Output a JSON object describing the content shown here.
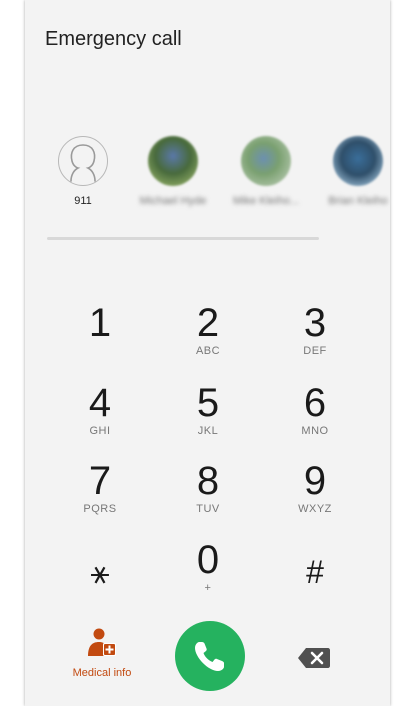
{
  "header": {
    "title": "Emergency call"
  },
  "contacts": [
    {
      "name": "911",
      "icon": "person-outline-icon"
    },
    {
      "name": "Michael Hyde"
    },
    {
      "name": "Mike Kleiho..."
    },
    {
      "name": "Brian Kleiho"
    }
  ],
  "keypad": [
    {
      "digit": "1",
      "letters": ""
    },
    {
      "digit": "2",
      "letters": "ABC"
    },
    {
      "digit": "3",
      "letters": "DEF"
    },
    {
      "digit": "4",
      "letters": "GHI"
    },
    {
      "digit": "5",
      "letters": "JKL"
    },
    {
      "digit": "6",
      "letters": "MNO"
    },
    {
      "digit": "7",
      "letters": "PQRS"
    },
    {
      "digit": "8",
      "letters": "TUV"
    },
    {
      "digit": "9",
      "letters": "WXYZ"
    },
    {
      "digit": "⚹",
      "letters": ""
    },
    {
      "digit": "0",
      "letters": "+"
    },
    {
      "digit": "#",
      "letters": ""
    }
  ],
  "bottom": {
    "medical_label": "Medical info",
    "medical_icon": "medical-info-icon",
    "call_icon": "phone-icon",
    "backspace_icon": "backspace-icon"
  },
  "colors": {
    "background": "#f3f3f3",
    "call_button": "#25b25f",
    "medical_accent": "#c24a10"
  }
}
